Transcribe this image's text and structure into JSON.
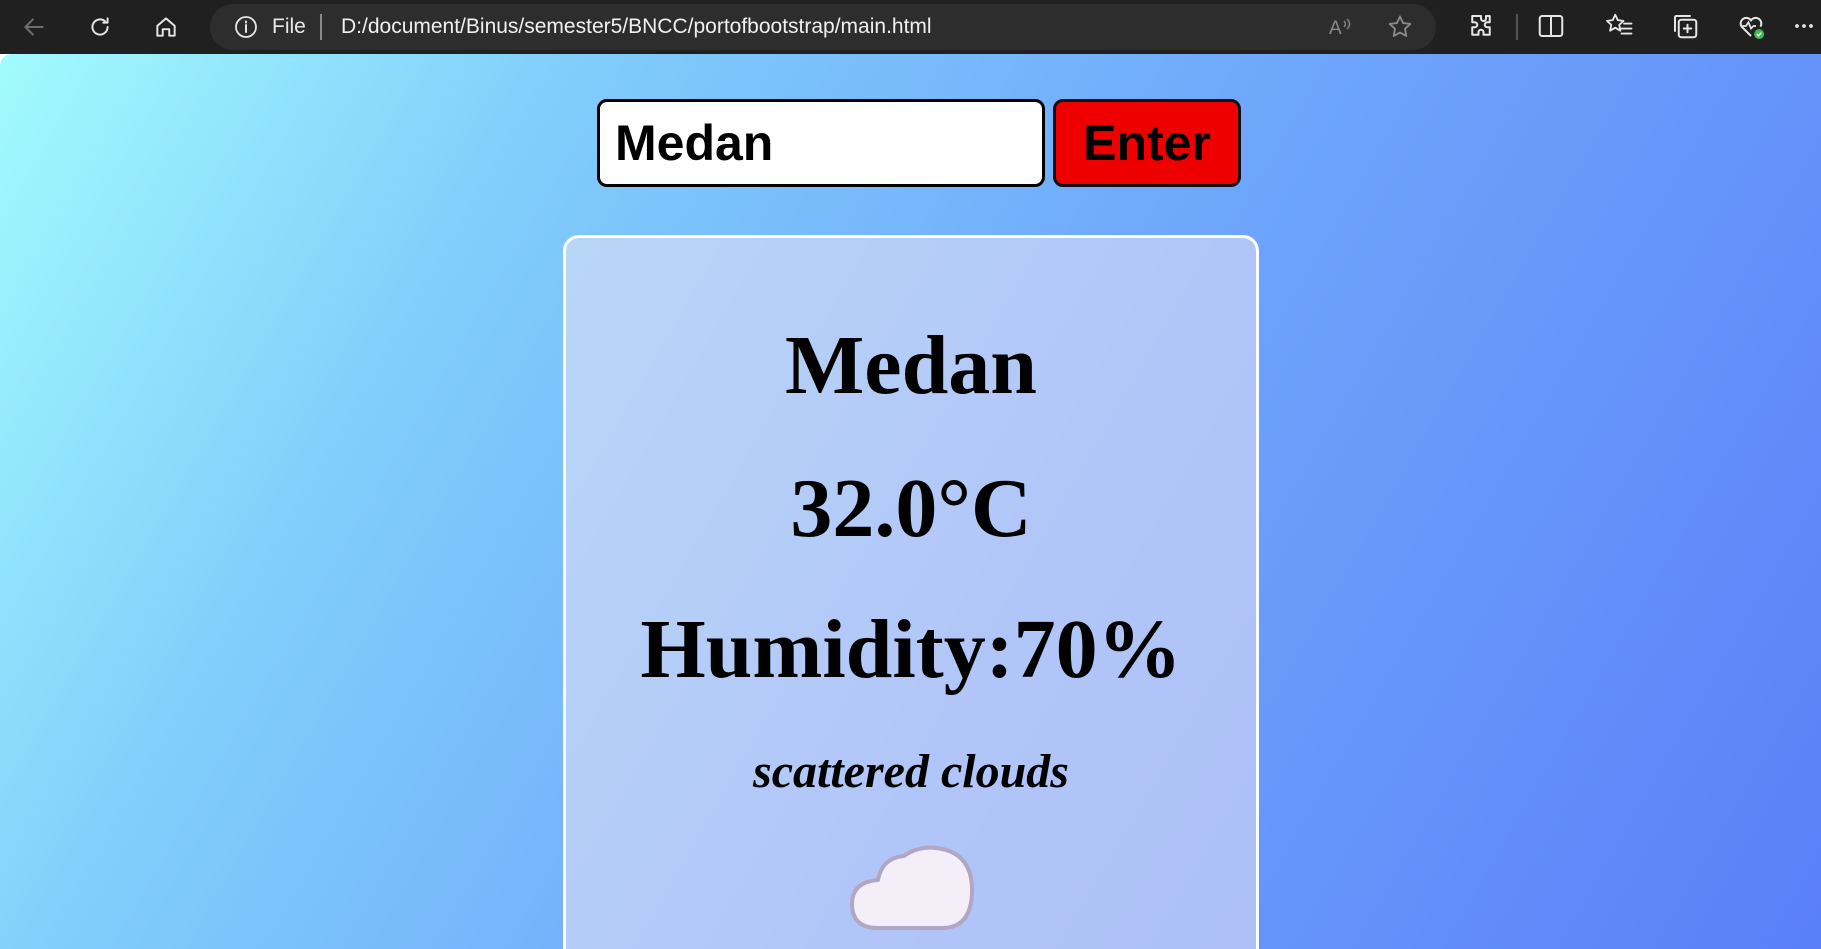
{
  "browser": {
    "address_scheme": "File",
    "address_url": "D:/document/Binus/semester5/BNCC/portofbootstrap/main.html"
  },
  "search": {
    "value": "Medan",
    "button_label": "Enter"
  },
  "weather": {
    "city": "Medan",
    "temperature": "32.0°C",
    "humidity": "Humidity:70%",
    "description": "scattered clouds",
    "icon": "cloud-icon"
  },
  "colors": {
    "browser_bar": "#202020",
    "enter_button": "#ee0000",
    "gradient_start": "#a2fbfd",
    "gradient_end": "#5a7ff8"
  }
}
